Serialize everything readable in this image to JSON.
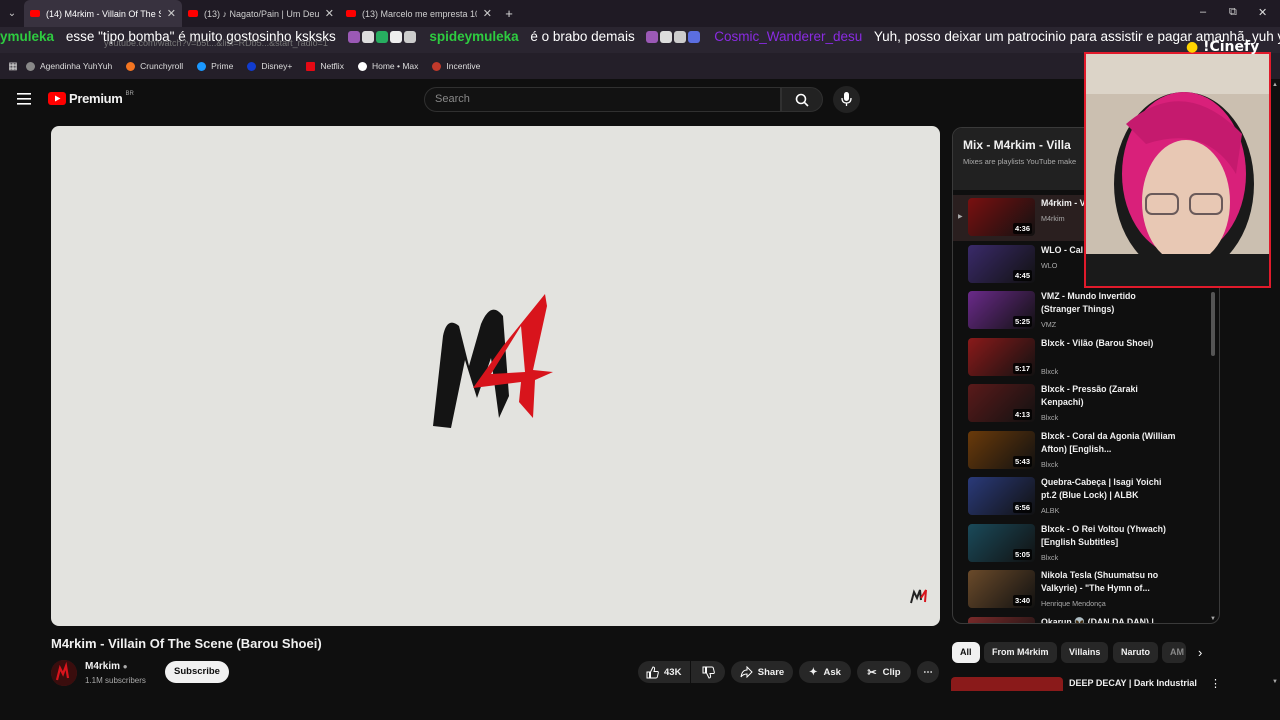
{
  "browser": {
    "tabs": [
      {
        "title": "(14) M4rkim - Villain Of The Sc",
        "active": true
      },
      {
        "title": "(13) ♪ Nagato/Pain | Um Deus |",
        "active": false
      },
      {
        "title": "(13) Marcelo me empresta 100",
        "active": false
      }
    ],
    "new_tab": "+",
    "url": "youtube.com/watch?v=b5t...&list=RDb5...&start_radio=1"
  },
  "chat_ticker": [
    {
      "user": "ymuleka",
      "msg": "esse \"tipo bomba\" é muito gostosinho ksksks"
    },
    {
      "user": "spideymuleka",
      "msg": "é o brabo demais"
    },
    {
      "user": "Cosmic_Wanderer_desu",
      "msg": "Yuh, posso deixar um patrocinio para assistir e pagar amanhã, yuh yuh"
    }
  ],
  "bookmarks": [
    "Agendinha YuhYuh",
    "Crunchyroll",
    "Prime",
    "Disney+",
    "Netflix",
    "Home • Max",
    "Incentive"
  ],
  "header": {
    "logo": "Premium",
    "region": "BR",
    "search_placeholder": "Search"
  },
  "video": {
    "title": "M4rkim - Villain Of The Scene (Barou Shoei)",
    "channel": "M4rkim",
    "subscribers": "1.1M subscribers",
    "subscribe_label": "Subscribe",
    "likes": "43K",
    "share_label": "Share",
    "ask_label": "Ask",
    "clip_label": "Clip",
    "more_label": "⋯"
  },
  "playlist": {
    "title": "Mix - M4rkim - Villa",
    "subtitle": "Mixes are playlists YouTube make",
    "items": [
      {
        "title": "M4rkim - V (Barou Sh",
        "channel": "M4rkim",
        "duration": "4:36",
        "color": "#7a1010"
      },
      {
        "title": "WLO - Cal Bizarre Ad",
        "channel": "WLO",
        "duration": "4:45",
        "color": "#3a2a6a"
      },
      {
        "title": "VMZ - Mundo Invertido (Stranger Things)",
        "channel": "VMZ",
        "duration": "5:25",
        "color": "#6a2a8a"
      },
      {
        "title": "Blxck - Vilão (Barou Shoei)",
        "channel": "Blxck",
        "duration": "5:17",
        "color": "#8a1a1a"
      },
      {
        "title": "Blxck - Pressão (Zaraki Kenpachi)",
        "channel": "Blxck",
        "duration": "4:13",
        "color": "#5a1a1a"
      },
      {
        "title": "Blxck - Coral da Agonia (William Afton) [English...",
        "channel": "Blxck",
        "duration": "5:43",
        "color": "#6a3a0a"
      },
      {
        "title": "Quebra-Cabeça | Isagi Yoichi pt.2 (Blue Lock) | ALBK",
        "channel": "ALBK",
        "duration": "6:56",
        "color": "#2a3a7a"
      },
      {
        "title": "Blxck - O Rei Voltou (Yhwach) [English Subtitles]",
        "channel": "Blxck",
        "duration": "5:05",
        "color": "#1a4a5a"
      },
      {
        "title": "Nikola Tesla (Shuumatsu no Valkyrie) - \"The Hymn of...",
        "channel": "Henrique Mendonça",
        "duration": "3:40",
        "color": "#6a4a2a"
      },
      {
        "title": "Okarun 👽 (DAN DA DAN) |",
        "channel": "",
        "duration": "",
        "color": "#7a2a2a"
      }
    ]
  },
  "chips": [
    "All",
    "From M4rkim",
    "Villains",
    "Naruto",
    "AM"
  ],
  "next_video": {
    "title": "DEEP DECAY | Dark Industrial"
  },
  "cam_label": "!Cinefy"
}
